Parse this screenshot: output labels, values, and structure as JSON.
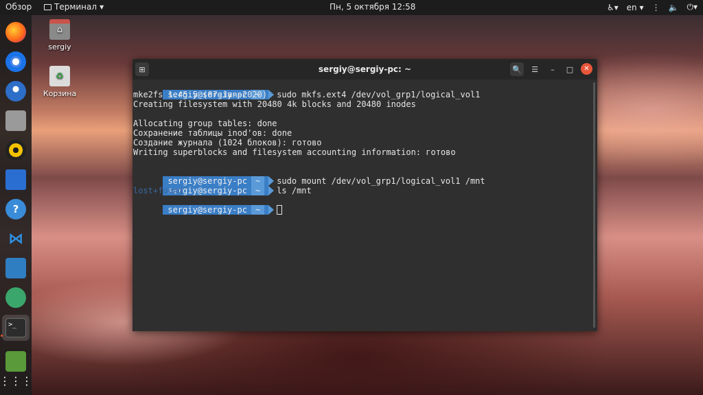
{
  "topbar": {
    "activities": "Обзор",
    "app_name": "Терминал",
    "app_caret": "▾",
    "clock": "Пн, 5 октября  12:58",
    "accessibility": "♿▾",
    "lang": "en",
    "lang_caret": "▾",
    "network": "⋮",
    "volume": "🔈",
    "power": "⏻",
    "system_caret": "▾"
  },
  "desktop": {
    "home_label": "sergiy",
    "trash_label": "Корзина"
  },
  "dock": {
    "items": [
      "firefox-icon",
      "chrome-icon",
      "thunderbird-icon",
      "files-icon",
      "rhythmbox-icon",
      "writer-icon",
      "help-icon",
      "vscode-icon",
      "system-monitor-icon",
      "remmina-icon",
      "terminal-icon",
      "disks-icon",
      "show-apps-icon"
    ],
    "terminal_glyph": ">_",
    "grid_glyph": "⋮⋮⋮"
  },
  "window": {
    "title": "sergiy@sergiy-pc: ~",
    "newtab_glyph": "⊞",
    "search_glyph": "🔍",
    "menu_glyph": "☰",
    "minimize_glyph": "–",
    "maximize_glyph": "□",
    "close_glyph": "✕"
  },
  "terminal": {
    "user_host": "sergiy@sergiy-pc",
    "dir": "~",
    "cmd1": "sudo mkfs.ext4 /dev/vol_grp1/logical_vol1",
    "out1": "mke2fs 1.45.5 (07-Jan-2020)",
    "out2": "Creating filesystem with 20480 4k blocks and 20480 inodes",
    "out3": "Allocating group tables: done",
    "out4": "Сохранение таблицы inod'ов: done",
    "out5": "Создание журнала (1024 блоков): готово",
    "out6": "Writing superblocks and filesystem accounting information: готово",
    "cmd2": "sudo mount /dev/vol_grp1/logical_vol1 /mnt",
    "cmd3": "ls /mnt",
    "out7": "lost+found"
  }
}
